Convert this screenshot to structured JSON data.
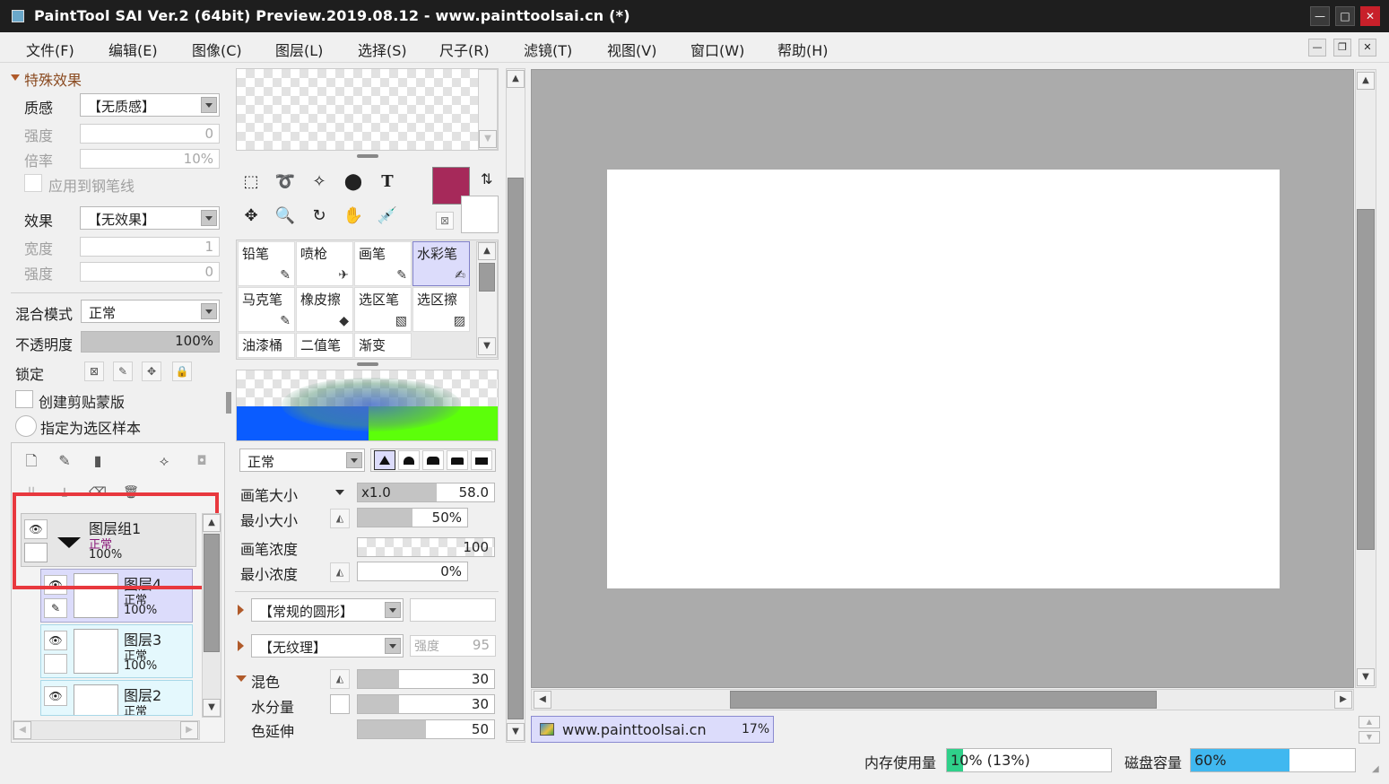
{
  "window": {
    "title": "PaintTool SAI Ver.2 (64bit) Preview.2019.08.12 - www.painttoolsai.cn (*)"
  },
  "menu": [
    "文件(F)",
    "编辑(E)",
    "图像(C)",
    "图层(L)",
    "选择(S)",
    "尺子(R)",
    "滤镜(T)",
    "视图(V)",
    "窗口(W)",
    "帮助(H)"
  ],
  "effects": {
    "section": "特殊效果",
    "texture_label": "质感",
    "texture_value": "【无质感】",
    "strength_label": "强度",
    "strength_value": "0",
    "scale_label": "倍率",
    "scale_value": "10%",
    "apply_pen_label": "应用到钢笔线",
    "effect_label": "效果",
    "effect_value": "【无效果】",
    "width_label": "宽度",
    "width_value": "1",
    "strength2_label": "强度",
    "strength2_value": "0"
  },
  "layer_props": {
    "blend_label": "混合模式",
    "blend_value": "正常",
    "opacity_label": "不透明度",
    "opacity_value": "100%",
    "lock_label": "锁定",
    "clip_label": "创建剪贴蒙版",
    "sample_label": "指定为选区样本"
  },
  "layers": [
    {
      "name": "图层组1",
      "mode": "正常",
      "opacity": "100%"
    },
    {
      "name": "图层4",
      "mode": "正常",
      "opacity": "100%"
    },
    {
      "name": "图层3",
      "mode": "正常",
      "opacity": "100%"
    },
    {
      "name": "图层2",
      "mode": "正常"
    }
  ],
  "brushes": [
    "铅笔",
    "喷枪",
    "画笔",
    "水彩笔",
    "马克笔",
    "橡皮擦",
    "选区笔",
    "选区擦",
    "油漆桶",
    "二值笔",
    "渐变"
  ],
  "brush_settings": {
    "mode_value": "正常",
    "size_label": "画笔大小",
    "size_mult": "x1.0",
    "size_value": "58.0",
    "minsize_label": "最小大小",
    "minsize_value": "50%",
    "density_label": "画笔浓度",
    "density_value": "100",
    "mindensity_label": "最小浓度",
    "mindensity_value": "0%",
    "shape_value": "【常规的圆形】",
    "texture_value": "【无纹理】",
    "texture_strength_label": "强度",
    "texture_strength_value": "95",
    "mix_label": "混色",
    "mix_value": "30",
    "water_label": "水分量",
    "water_value": "30",
    "extend_label": "色延伸",
    "extend_value": "50"
  },
  "colors": {
    "primary": "#a6295a",
    "canvas_bg": "#ababab"
  },
  "tabs": [
    {
      "name": "www.painttoolsai.cn",
      "zoom": "17%"
    }
  ],
  "status": {
    "mem_label": "内存使用量",
    "mem_value": "10% (13%)",
    "mem_progress": 0.1,
    "disk_label": "磁盘容量",
    "disk_value": "60%",
    "disk_progress": 0.6
  }
}
